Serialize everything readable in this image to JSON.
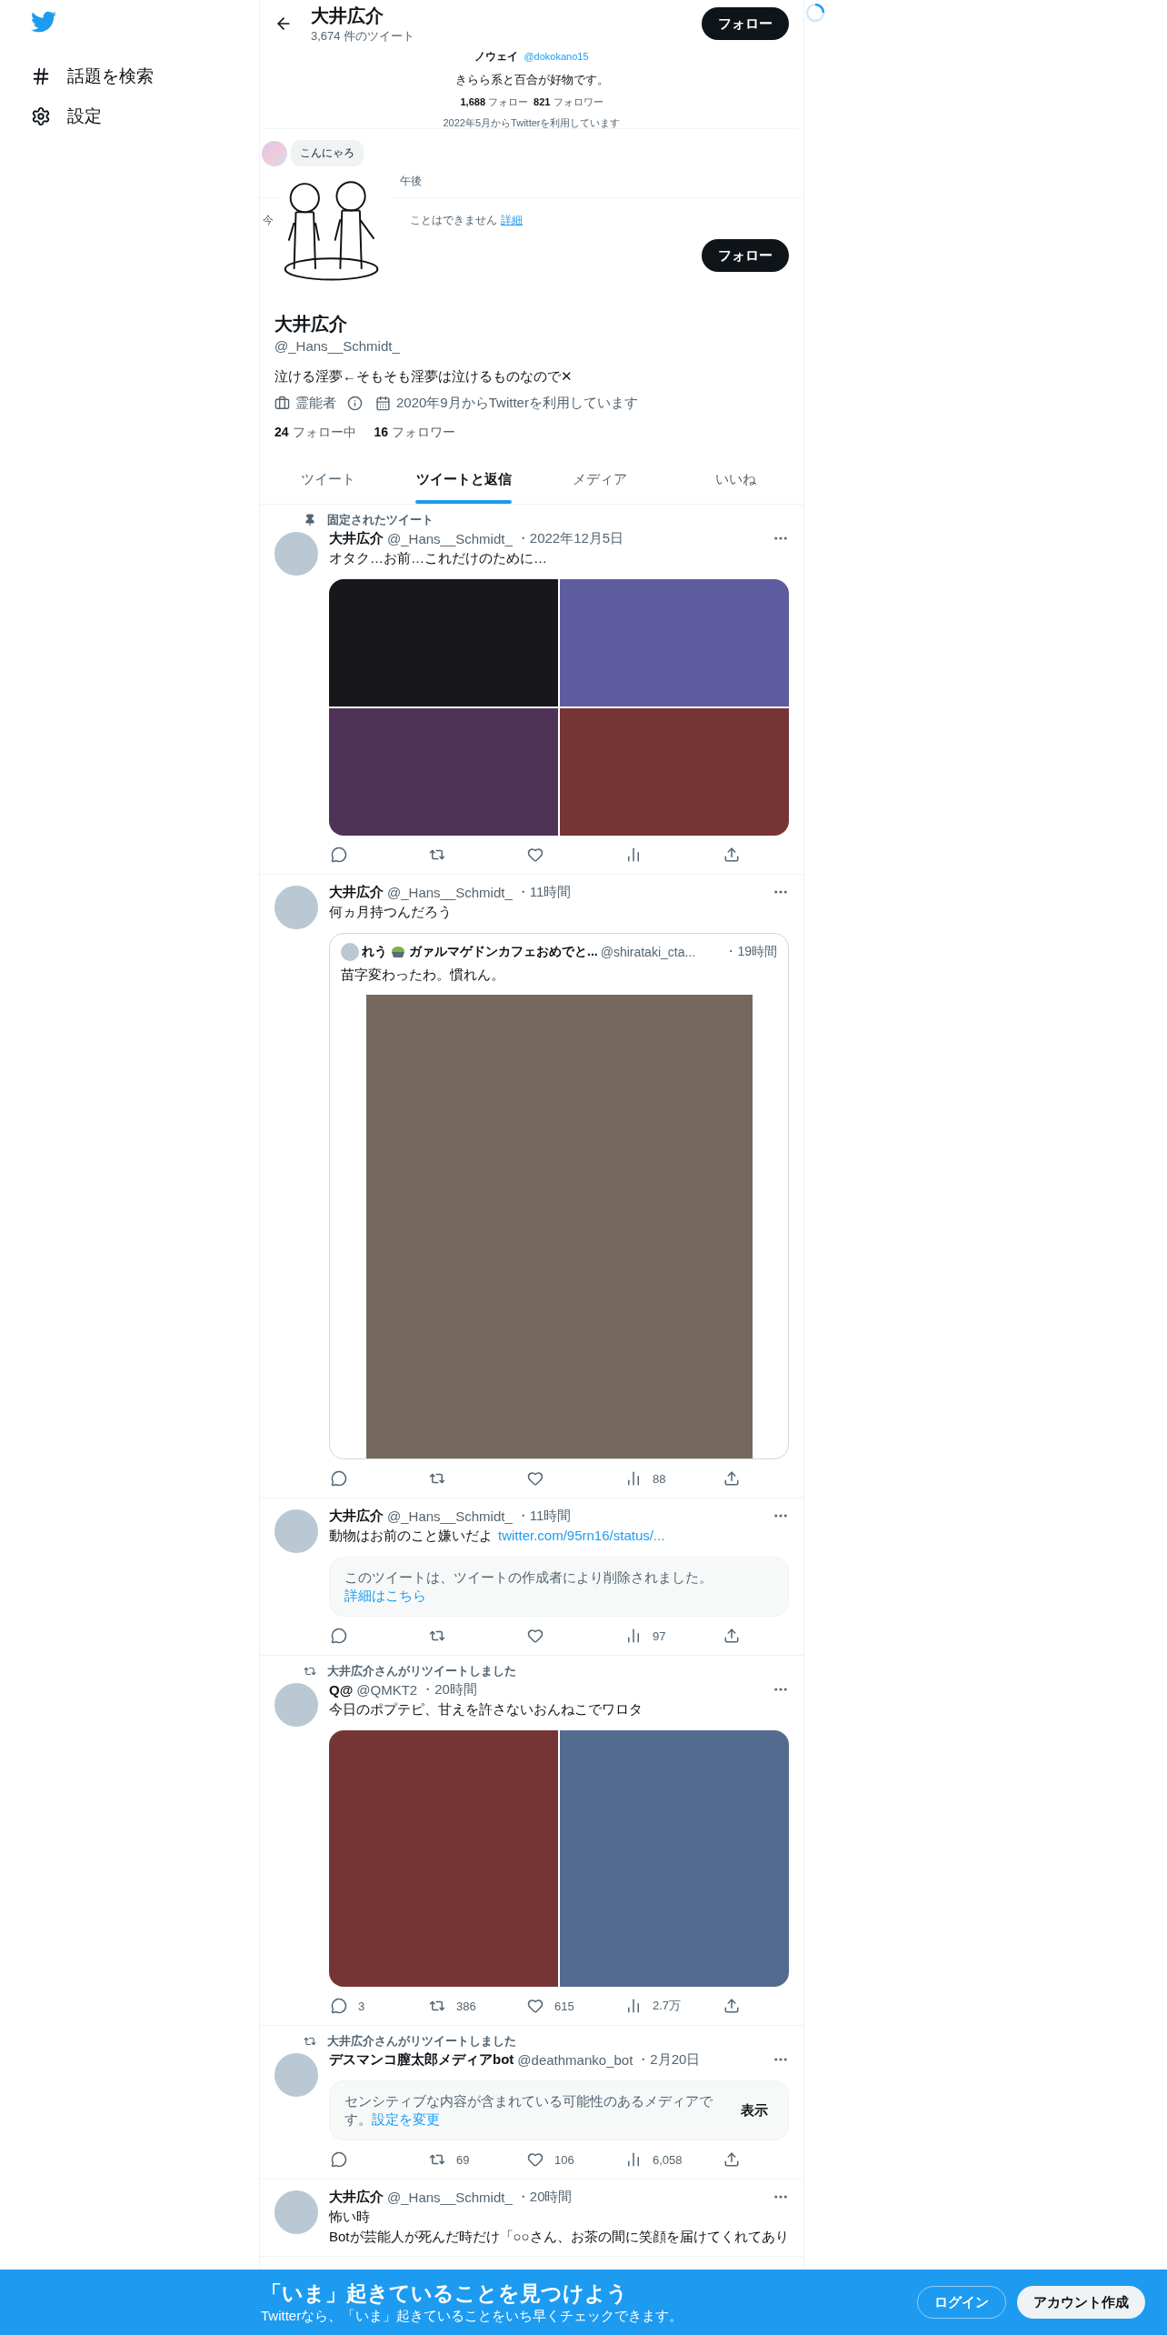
{
  "sidebar": {
    "items": [
      {
        "kind": "hash",
        "label": "話題を検索"
      },
      {
        "kind": "settings",
        "label": "設定"
      }
    ]
  },
  "header": {
    "name": "大井広介",
    "tweet_count": "3,674 件のツイート",
    "follow_button": "フォロー"
  },
  "banner": {
    "author": "ノウェイ",
    "handle": "@dokokano15",
    "bio": "きらら系と百合が好物です。",
    "counts": [
      {
        "count": "1,688",
        "label": "フォロー"
      },
      {
        "count": "821",
        "label": "フォロワー"
      }
    ],
    "joined": "2022年5月からTwitterを利用しています",
    "chat": {
      "message": "こんにゃろ",
      "time": "午後"
    },
    "notice_start": "今",
    "notice": "ことはできません",
    "notice_link": "詳細"
  },
  "profile": {
    "avatar": {
      "kind": "picture"
    },
    "follow_button": "フォロー",
    "name": "大井広介",
    "handle": "@_Hans__Schmidt_",
    "bio": "泣ける淫夢←そもそも淫夢は泣けるものなので✕",
    "meta": [
      {
        "kind": "job",
        "text": "霊能者"
      },
      {
        "kind": "joined",
        "text": "2020年9月からTwitterを利用しています"
      }
    ],
    "stats": [
      {
        "count": "24",
        "label": "フォロー中"
      },
      {
        "count": "16",
        "label": "フォロワー"
      }
    ]
  },
  "tabs": [
    {
      "label": "ツイート",
      "selected": false
    },
    {
      "label": "ツイートと返信",
      "selected": true
    },
    {
      "label": "メディア",
      "selected": false
    },
    {
      "label": "いいね",
      "selected": false
    }
  ],
  "tweets": [
    {
      "context": {
        "kind": "pinned",
        "text": "固定されたツイート"
      },
      "author": "大井広介",
      "handle": "@_Hans__Schmidt_",
      "time": "・2022年12月5日",
      "text": [
        "オタク…お前…これだけのために…"
      ],
      "media": [
        {
          "kind": "picture",
          "color": "#18171c"
        },
        {
          "kind": "picture",
          "color": "#5e5b9e"
        },
        {
          "kind": "picture",
          "color": "#4e3357"
        },
        {
          "kind": "picture",
          "color": "#763535"
        }
      ],
      "actions": [
        {
          "kind": "reply"
        },
        {
          "kind": "retweet"
        },
        {
          "kind": "like"
        },
        {
          "kind": "views"
        },
        {
          "kind": "share"
        }
      ]
    },
    {
      "author": "大井広介",
      "handle": "@_Hans__Schmidt_",
      "time": "・11時間",
      "text": [
        "何ヵ月持つんだろう"
      ],
      "quote": {
        "name": "れう",
        "name_rest": "ガァルマゲドンカフェおめでと...",
        "handle": "@shirataki_cta...",
        "time": "・19時間",
        "text": "苗字変わったわ。慣れん。",
        "media": [
          {
            "kind": "picture",
            "color": "#75695d"
          }
        ]
      },
      "actions": [
        {
          "kind": "reply"
        },
        {
          "kind": "retweet"
        },
        {
          "kind": "like"
        },
        {
          "kind": "views",
          "count": "88"
        },
        {
          "kind": "share"
        }
      ]
    },
    {
      "author": "大井広介",
      "handle": "@_Hans__Schmidt_",
      "time": "・11時間",
      "text": [
        "動物はお前のこと嫌いだよ"
      ],
      "link": "twitter.com/95rn16/status/...",
      "notice": {
        "kind": "deleted",
        "text": "このツイートは、ツイートの作成者により削除されました。",
        "link": "詳細はこちら"
      },
      "actions": [
        {
          "kind": "reply"
        },
        {
          "kind": "retweet"
        },
        {
          "kind": "like"
        },
        {
          "kind": "views",
          "count": "97"
        },
        {
          "kind": "share"
        }
      ]
    },
    {
      "context": {
        "kind": "retweet",
        "text": "大井広介さんがリツイートしました"
      },
      "author": "Q@",
      "handle": "@QMKT2",
      "time": "・20時間",
      "text": [
        "今日のポプテピ、甘えを許さないおんねこでワロタ"
      ],
      "media": [
        {
          "kind": "picture",
          "color": "#763535"
        },
        {
          "kind": "picture",
          "color": "#536b8e"
        }
      ],
      "actions": [
        {
          "kind": "reply",
          "count": "3"
        },
        {
          "kind": "retweet",
          "count": "386"
        },
        {
          "kind": "like",
          "count": "615"
        },
        {
          "kind": "views",
          "count": "2.7万"
        },
        {
          "kind": "share"
        }
      ]
    },
    {
      "context": {
        "kind": "retweet",
        "text": "大井広介さんがリツイートしました"
      },
      "author": "デスマンコ膣太郎メディアbot",
      "handle": "@deathmanko_bot",
      "time": "・2月20日",
      "notice": {
        "kind": "sensitive",
        "text": "センシティブな内容が含まれている可能性のあるメディアです。",
        "link": "設定を変更",
        "button": "表示"
      },
      "actions": [
        {
          "kind": "reply"
        },
        {
          "kind": "retweet",
          "count": "69"
        },
        {
          "kind": "like",
          "count": "106"
        },
        {
          "kind": "views",
          "count": "6,058"
        },
        {
          "kind": "share"
        }
      ]
    },
    {
      "author": "大井広介",
      "handle": "@_Hans__Schmidt_",
      "time": "・20時間",
      "text": [
        "怖い時",
        "Botが芸能人が死んだ時だけ「○○さん、お茶の間に笑顔を届けてくれてあり"
      ]
    }
  ],
  "signup_bar": {
    "title": "「いま」起きていることを見つけよう",
    "subtitle": "Twitterなら、「いま」起きていることをいち早くチェックできます。",
    "login": "ログイン",
    "signup": "アカウント作成"
  }
}
